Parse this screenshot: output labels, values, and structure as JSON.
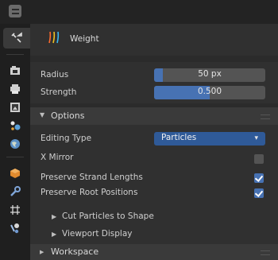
{
  "sidebar": {
    "tabs": [
      {
        "name": "tool-tab",
        "icon": "🔧",
        "active": true
      },
      {
        "name": "render-tab",
        "icon": "📷"
      },
      {
        "name": "output-tab",
        "icon": "🖨"
      },
      {
        "name": "view-layer-tab",
        "icon": "🖼"
      },
      {
        "name": "scene-tab",
        "icon": "🧪"
      },
      {
        "name": "world-tab",
        "icon": "🌐"
      },
      {
        "name": "object-tab",
        "icon": "🟧"
      },
      {
        "name": "modifier-tab",
        "icon": "🔧"
      },
      {
        "name": "particles-tab",
        "icon": "✳"
      },
      {
        "name": "physics-tab",
        "icon": "🌓"
      }
    ]
  },
  "brush": {
    "name": "Weight"
  },
  "fields": {
    "radius": {
      "label": "Radius",
      "value": "50 px",
      "fill_fraction": 0.08
    },
    "strength": {
      "label": "Strength",
      "value": "0.500",
      "fill_fraction": 0.5
    }
  },
  "options": {
    "title": "Options",
    "editing_type": {
      "label": "Editing Type",
      "value": "Particles"
    },
    "x_mirror": {
      "label": "X Mirror",
      "checked": false
    },
    "preserve_strand_lengths": {
      "label": "Preserve Strand Lengths",
      "checked": true
    },
    "preserve_root_positions": {
      "label": "Preserve Root Positions",
      "checked": true
    },
    "subpanels": [
      {
        "title": "Cut Particles to Shape"
      },
      {
        "title": "Viewport Display"
      }
    ]
  },
  "workspace": {
    "title": "Workspace"
  },
  "colors": {
    "accent": "#4772b3",
    "dropdown": "#2f5a98",
    "panel": "#303030",
    "header": "#3a3a3a"
  }
}
